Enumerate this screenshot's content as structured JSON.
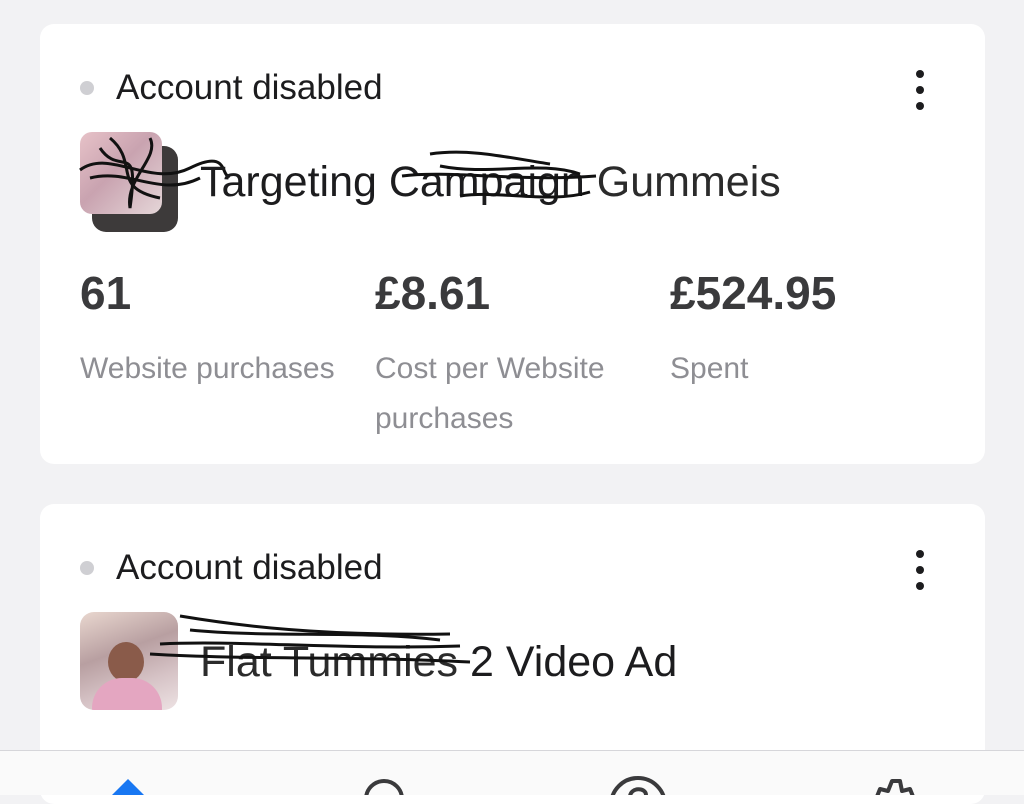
{
  "cards": [
    {
      "status": "Account disabled",
      "ad_name": "Targeting Campaign",
      "ad_name_redacted": "Gummeis",
      "metrics": [
        {
          "value": "61",
          "label": "Website purchases"
        },
        {
          "value": "£8.61",
          "label": "Cost per Website purchases"
        },
        {
          "value": "£524.95",
          "label": "Spent"
        }
      ]
    },
    {
      "status": "Account disabled",
      "ad_name_redacted": "Flat Tummies",
      "ad_name": "2 Video Ad"
    }
  ],
  "tabbar": {
    "icons": [
      "home-icon",
      "search-icon",
      "help-icon",
      "settings-icon"
    ],
    "accent": "#1877f2"
  }
}
